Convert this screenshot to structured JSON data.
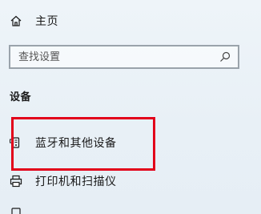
{
  "nav": {
    "home_label": "主页",
    "home_icon": "home-icon"
  },
  "search": {
    "placeholder": "查找设置",
    "icon": "search-icon"
  },
  "section": {
    "title": "设备"
  },
  "items": [
    {
      "label": "蓝牙和其他设备",
      "icon": "bluetooth-devices-icon",
      "highlighted": true
    },
    {
      "label": "打印机和扫描仪",
      "icon": "printer-icon",
      "highlighted": false
    }
  ],
  "colors": {
    "highlight_border": "#e2001a",
    "background": "#e9f1f7",
    "text": "#1a1a1a"
  }
}
